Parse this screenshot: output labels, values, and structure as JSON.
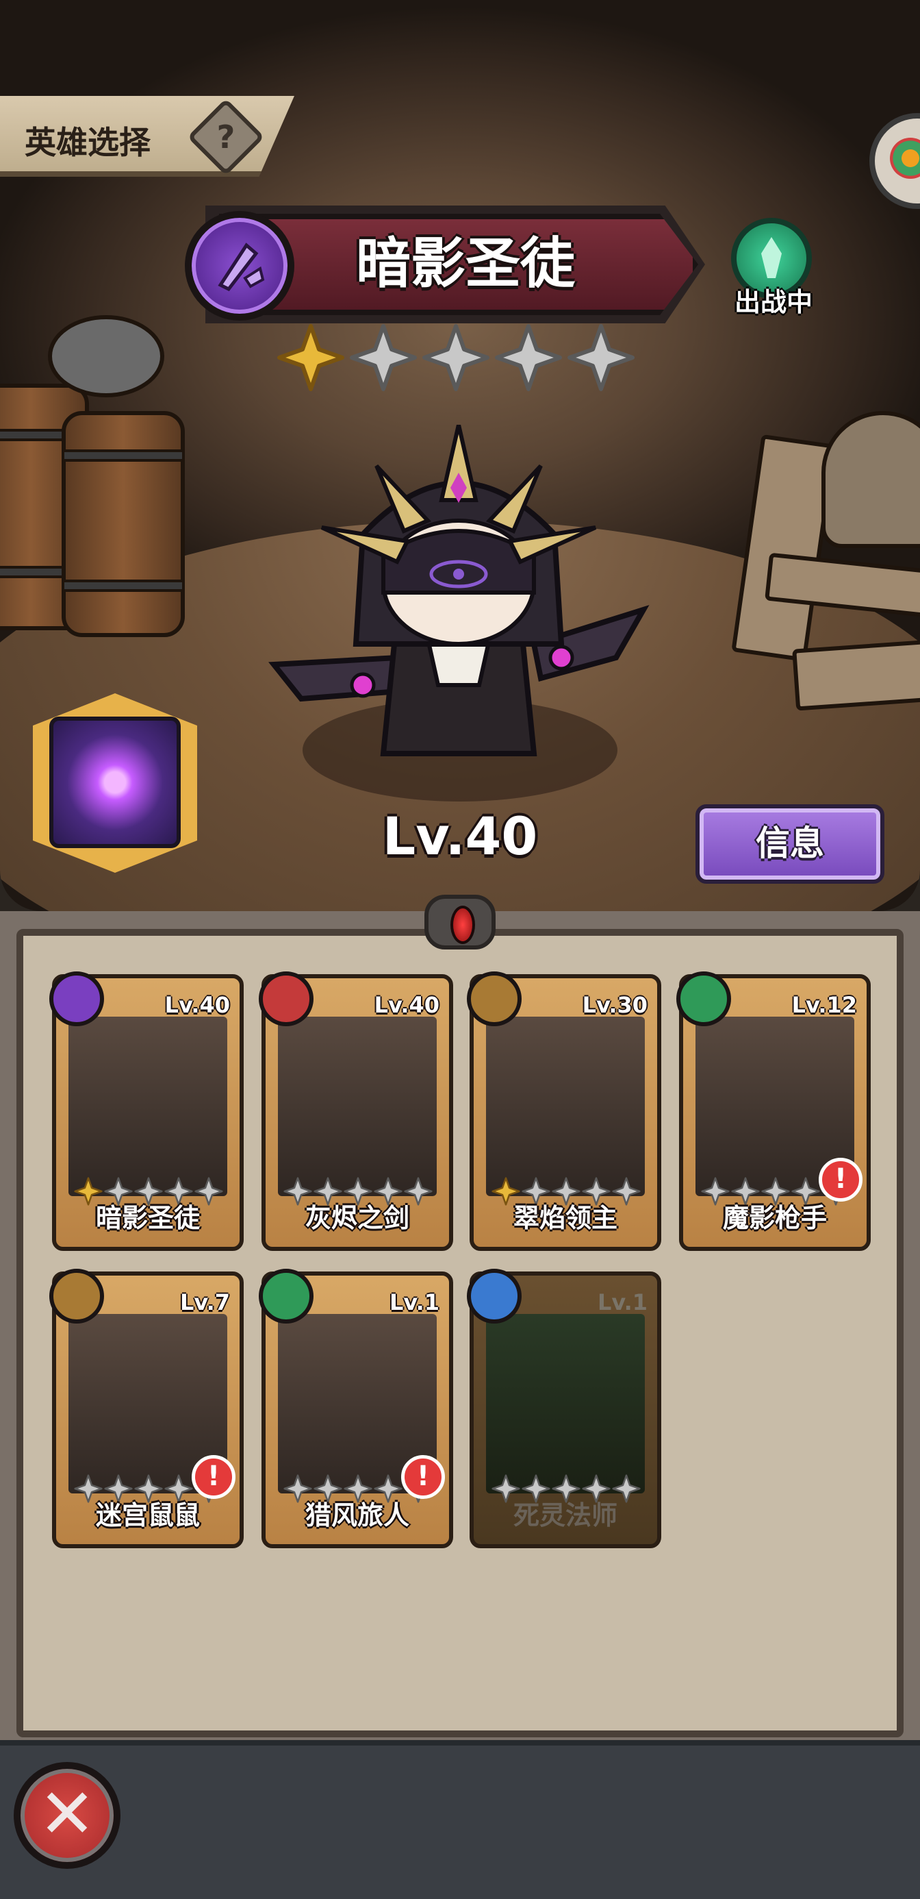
{
  "header": {
    "title": "英雄选择",
    "help_icon": "?"
  },
  "selected_hero": {
    "name": "暗影圣徒",
    "stars_filled": 1,
    "stars_total": 5,
    "level": "Lv.40",
    "status": "出战中"
  },
  "info_button": "信息",
  "colors": {
    "gold_star": "#e8b93a",
    "empty_star": "#c8c8c8",
    "banner": "#6a2432",
    "info_purple": "#8f5fd0"
  },
  "heroes": [
    {
      "name": "暗影圣徒",
      "level": "Lv.40",
      "class_color": "#7a3fc0",
      "stars": 1,
      "alert": false,
      "locked": false
    },
    {
      "name": "灰烬之剑",
      "level": "Lv.40",
      "class_color": "#c43a3a",
      "stars": 0,
      "alert": false,
      "locked": false
    },
    {
      "name": "翠焰领主",
      "level": "Lv.30",
      "class_color": "#a87a34",
      "stars": 1,
      "alert": false,
      "locked": false
    },
    {
      "name": "魔影枪手",
      "level": "Lv.12",
      "class_color": "#2f9a58",
      "stars": 0,
      "alert": true,
      "locked": false
    },
    {
      "name": "迷宫鼠鼠",
      "level": "Lv.7",
      "class_color": "#a87a34",
      "stars": 0,
      "alert": true,
      "locked": false
    },
    {
      "name": "猎风旅人",
      "level": "Lv.1",
      "class_color": "#2f9a58",
      "stars": 0,
      "alert": true,
      "locked": false
    },
    {
      "name": "死灵法师",
      "level": "Lv.1",
      "class_color": "#3a7ad0",
      "stars": 0,
      "alert": false,
      "locked": true
    }
  ],
  "alert_icon": "!",
  "close_icon": "✕"
}
